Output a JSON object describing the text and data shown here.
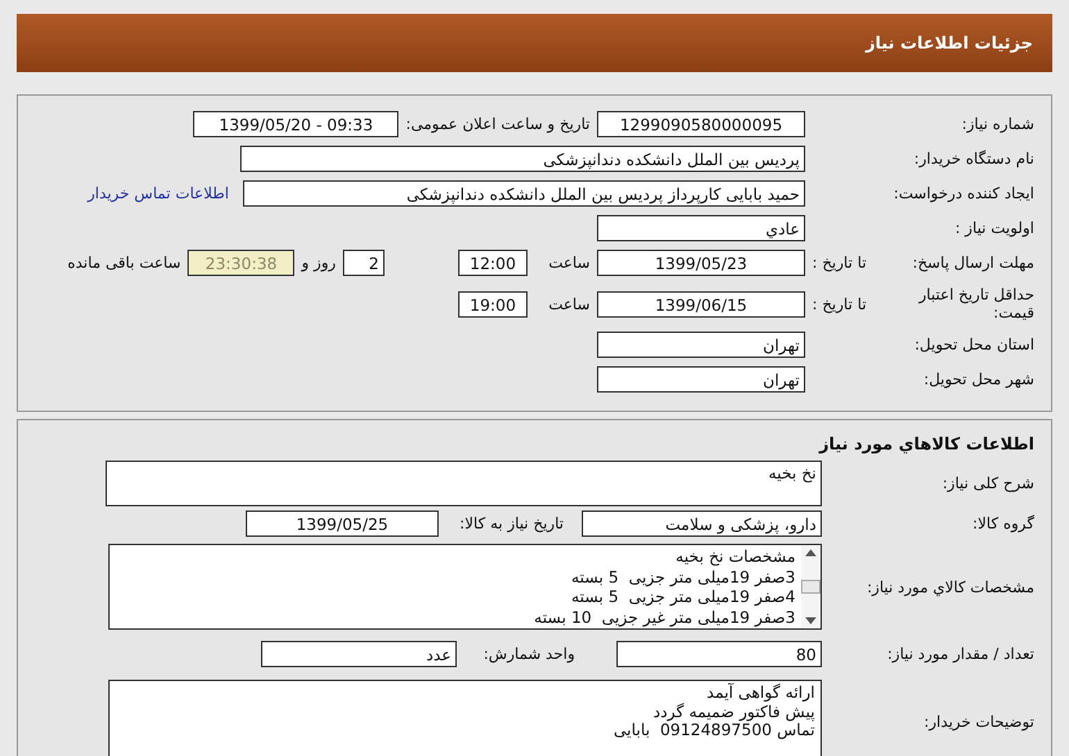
{
  "header": {
    "title": "جزئیات اطلاعات نیاز"
  },
  "need_info": {
    "need_number": {
      "label": "شماره نیاز:",
      "value": "1299090580000095"
    },
    "announce": {
      "label": "تاریخ و ساعت اعلان عمومی:",
      "value": "1399/05/20 - 09:33"
    },
    "buyer_org": {
      "label": "نام دستگاه خریدار:",
      "value": "پردیس بین الملل دانشکده دندانپزشکی"
    },
    "requester": {
      "label": "ایجاد کننده درخواست:",
      "value": "حمید بابایی کارپرداز پردیس بین الملل دانشکده دندانپزشکی"
    },
    "contact_link": "اطلاعات تماس خریدار",
    "priority": {
      "label": "اولویت نیاز :",
      "value": "عادي"
    },
    "reply_deadline": {
      "label": "مهلت ارسال پاسخ:",
      "to_date_label": "تا تاریخ :",
      "date": "1399/05/23",
      "time_label": "ساعت",
      "time": "12:00",
      "days": "2",
      "days_label": "روز و",
      "remaining": "23:30:38",
      "remaining_label": "ساعت باقی مانده"
    },
    "price_validity": {
      "label": "حداقل تاریخ اعتبار قیمت:",
      "to_date_label": "تا تاریخ :",
      "date": "1399/06/15",
      "time_label": "ساعت",
      "time": "19:00"
    },
    "province": {
      "label": "استان محل تحویل:",
      "value": "تهران"
    },
    "city": {
      "label": "شهر محل تحویل:",
      "value": "تهران"
    }
  },
  "goods": {
    "title": "اطلاعات كالاهاي مورد نياز",
    "description": {
      "label": "شرح کلی نیاز:",
      "value": "نخ بخیه"
    },
    "group": {
      "label": "گروه کالا:",
      "value": "دارو، پزشکی و سلامت"
    },
    "need_date": {
      "label": "تاریخ نیاز به کالا:",
      "value": "1399/05/25"
    },
    "specs": {
      "label": "مشخصات كالاي مورد نياز:",
      "lines": [
        "مشخصات نخ بخیه",
        "3صفر 19میلی متر جزیی  5 بسته",
        "4صفر 19میلی متر جزیی  5 بسته",
        "3صفر 19میلی متر غیر جزیی  10 بسته"
      ]
    },
    "quantity": {
      "label": "تعداد / مقدار مورد نیاز:",
      "value": "80"
    },
    "unit": {
      "label": "واحد شمارش:",
      "value": "عدد"
    },
    "buyer_notes": {
      "label": "توضیحات خریدار:",
      "lines": [
        "ارائه گواهی آیمد",
        "پیش فاکتور ضمیمه گردد",
        "تماس 09124897500  بابایی"
      ]
    }
  }
}
